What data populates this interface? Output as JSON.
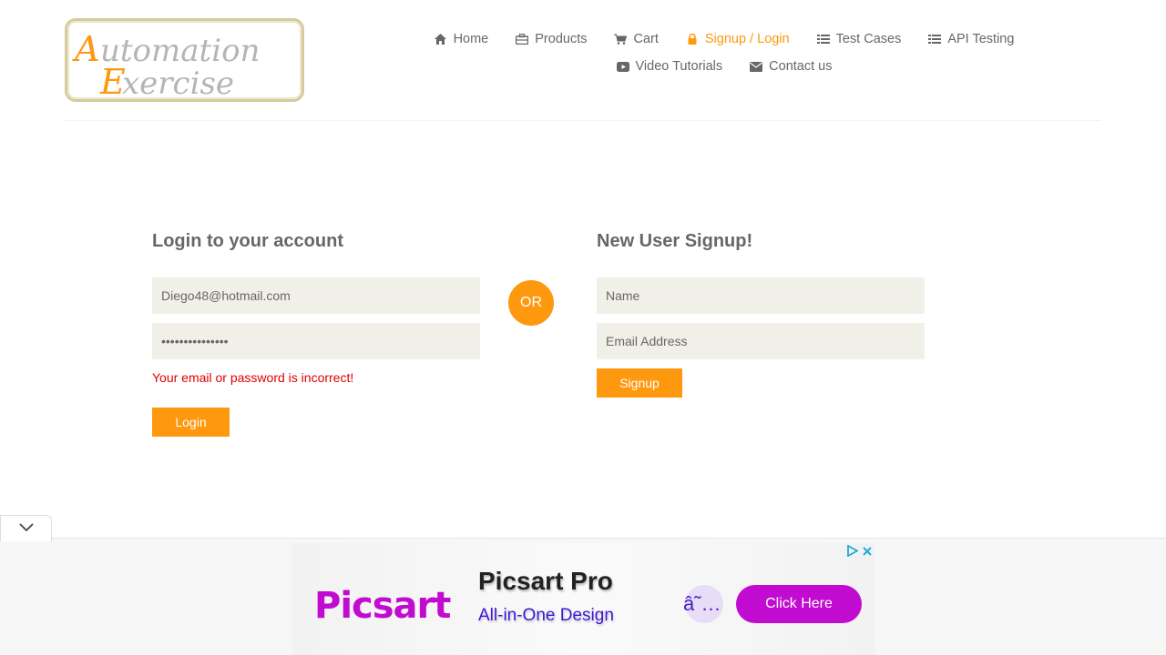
{
  "logo": {
    "line1": "Automation",
    "line2": "Exercise"
  },
  "nav": {
    "items": [
      {
        "label": "Home",
        "icon": "home-icon"
      },
      {
        "label": "Products",
        "icon": "briefcase-icon"
      },
      {
        "label": "Cart",
        "icon": "cart-icon"
      },
      {
        "label": "Signup / Login",
        "icon": "lock-icon",
        "active": true
      },
      {
        "label": "Test Cases",
        "icon": "list-icon"
      },
      {
        "label": "API Testing",
        "icon": "list-icon"
      },
      {
        "label": "Video Tutorials",
        "icon": "youtube-icon"
      },
      {
        "label": "Contact us",
        "icon": "envelope-icon"
      }
    ]
  },
  "login": {
    "title": "Login to your account",
    "email_value": "Diego48@hotmail.com",
    "password_value": "•••••••••••••••",
    "error": "Your email or password is incorrect!",
    "button": "Login"
  },
  "or_label": "OR",
  "signup": {
    "title": "New User Signup!",
    "name_placeholder": "Name",
    "email_placeholder": "Email Address",
    "button": "Signup"
  },
  "ad": {
    "brand": "Picsart",
    "title": "Picsart Pro",
    "subtitle": "All-in-One Design",
    "glyph": "â˜…",
    "cta": "Click Here"
  },
  "colors": {
    "accent": "#FE980F",
    "error": "#e00000",
    "ad_brand": "#c20bd1"
  }
}
